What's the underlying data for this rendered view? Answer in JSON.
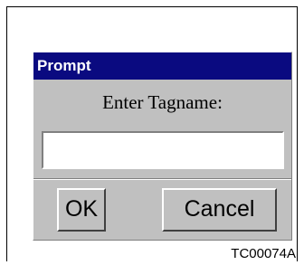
{
  "dialog": {
    "title": "Prompt",
    "prompt_label": "Enter Tagname:",
    "input": {
      "value": "",
      "placeholder": ""
    },
    "buttons": {
      "ok_label": "OK",
      "cancel_label": "Cancel"
    }
  },
  "figure_id": "TC00074A",
  "colors": {
    "titlebar_bg": "#0a0a80",
    "titlebar_text": "#ffffff",
    "dialog_bg": "#c0c0c0",
    "input_bg": "#ffffff"
  }
}
